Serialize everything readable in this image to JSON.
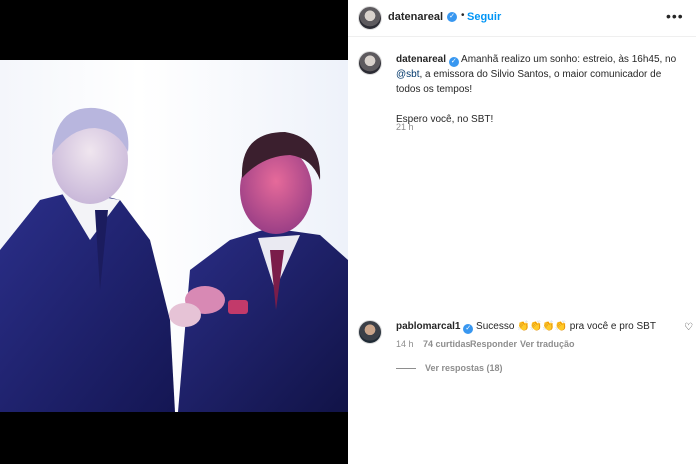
{
  "post": {
    "username": "datenareal",
    "follow_label": "Seguir",
    "caption_line": "Amanhã realizo um sonho: estreio, às 16h45, no",
    "caption_mention": "@sbt",
    "caption_rest": ", a emissora do Silvio Santos, o maior comunicador de todos os tempos!",
    "caption_second": "Espero você, no SBT!",
    "time": "21 h"
  },
  "comment": {
    "username": "pablomarcal1",
    "text_before": "Sucesso",
    "emoji": "👏👏👏👏",
    "text_after": "pra você e pro SBT",
    "time": "14 h",
    "likes": "74 curtidas",
    "reply_label": "Responder",
    "translate_label": "Ver tradução",
    "view_replies": "Ver respostas (18)"
  },
  "icons": {
    "verified": "verified-badge-icon",
    "more": "more-options-icon",
    "heart": "heart-icon"
  },
  "colors": {
    "link_blue": "#0095f6",
    "verified_blue": "#3897f0",
    "mention": "#00376b",
    "muted": "#8e8e8e"
  }
}
